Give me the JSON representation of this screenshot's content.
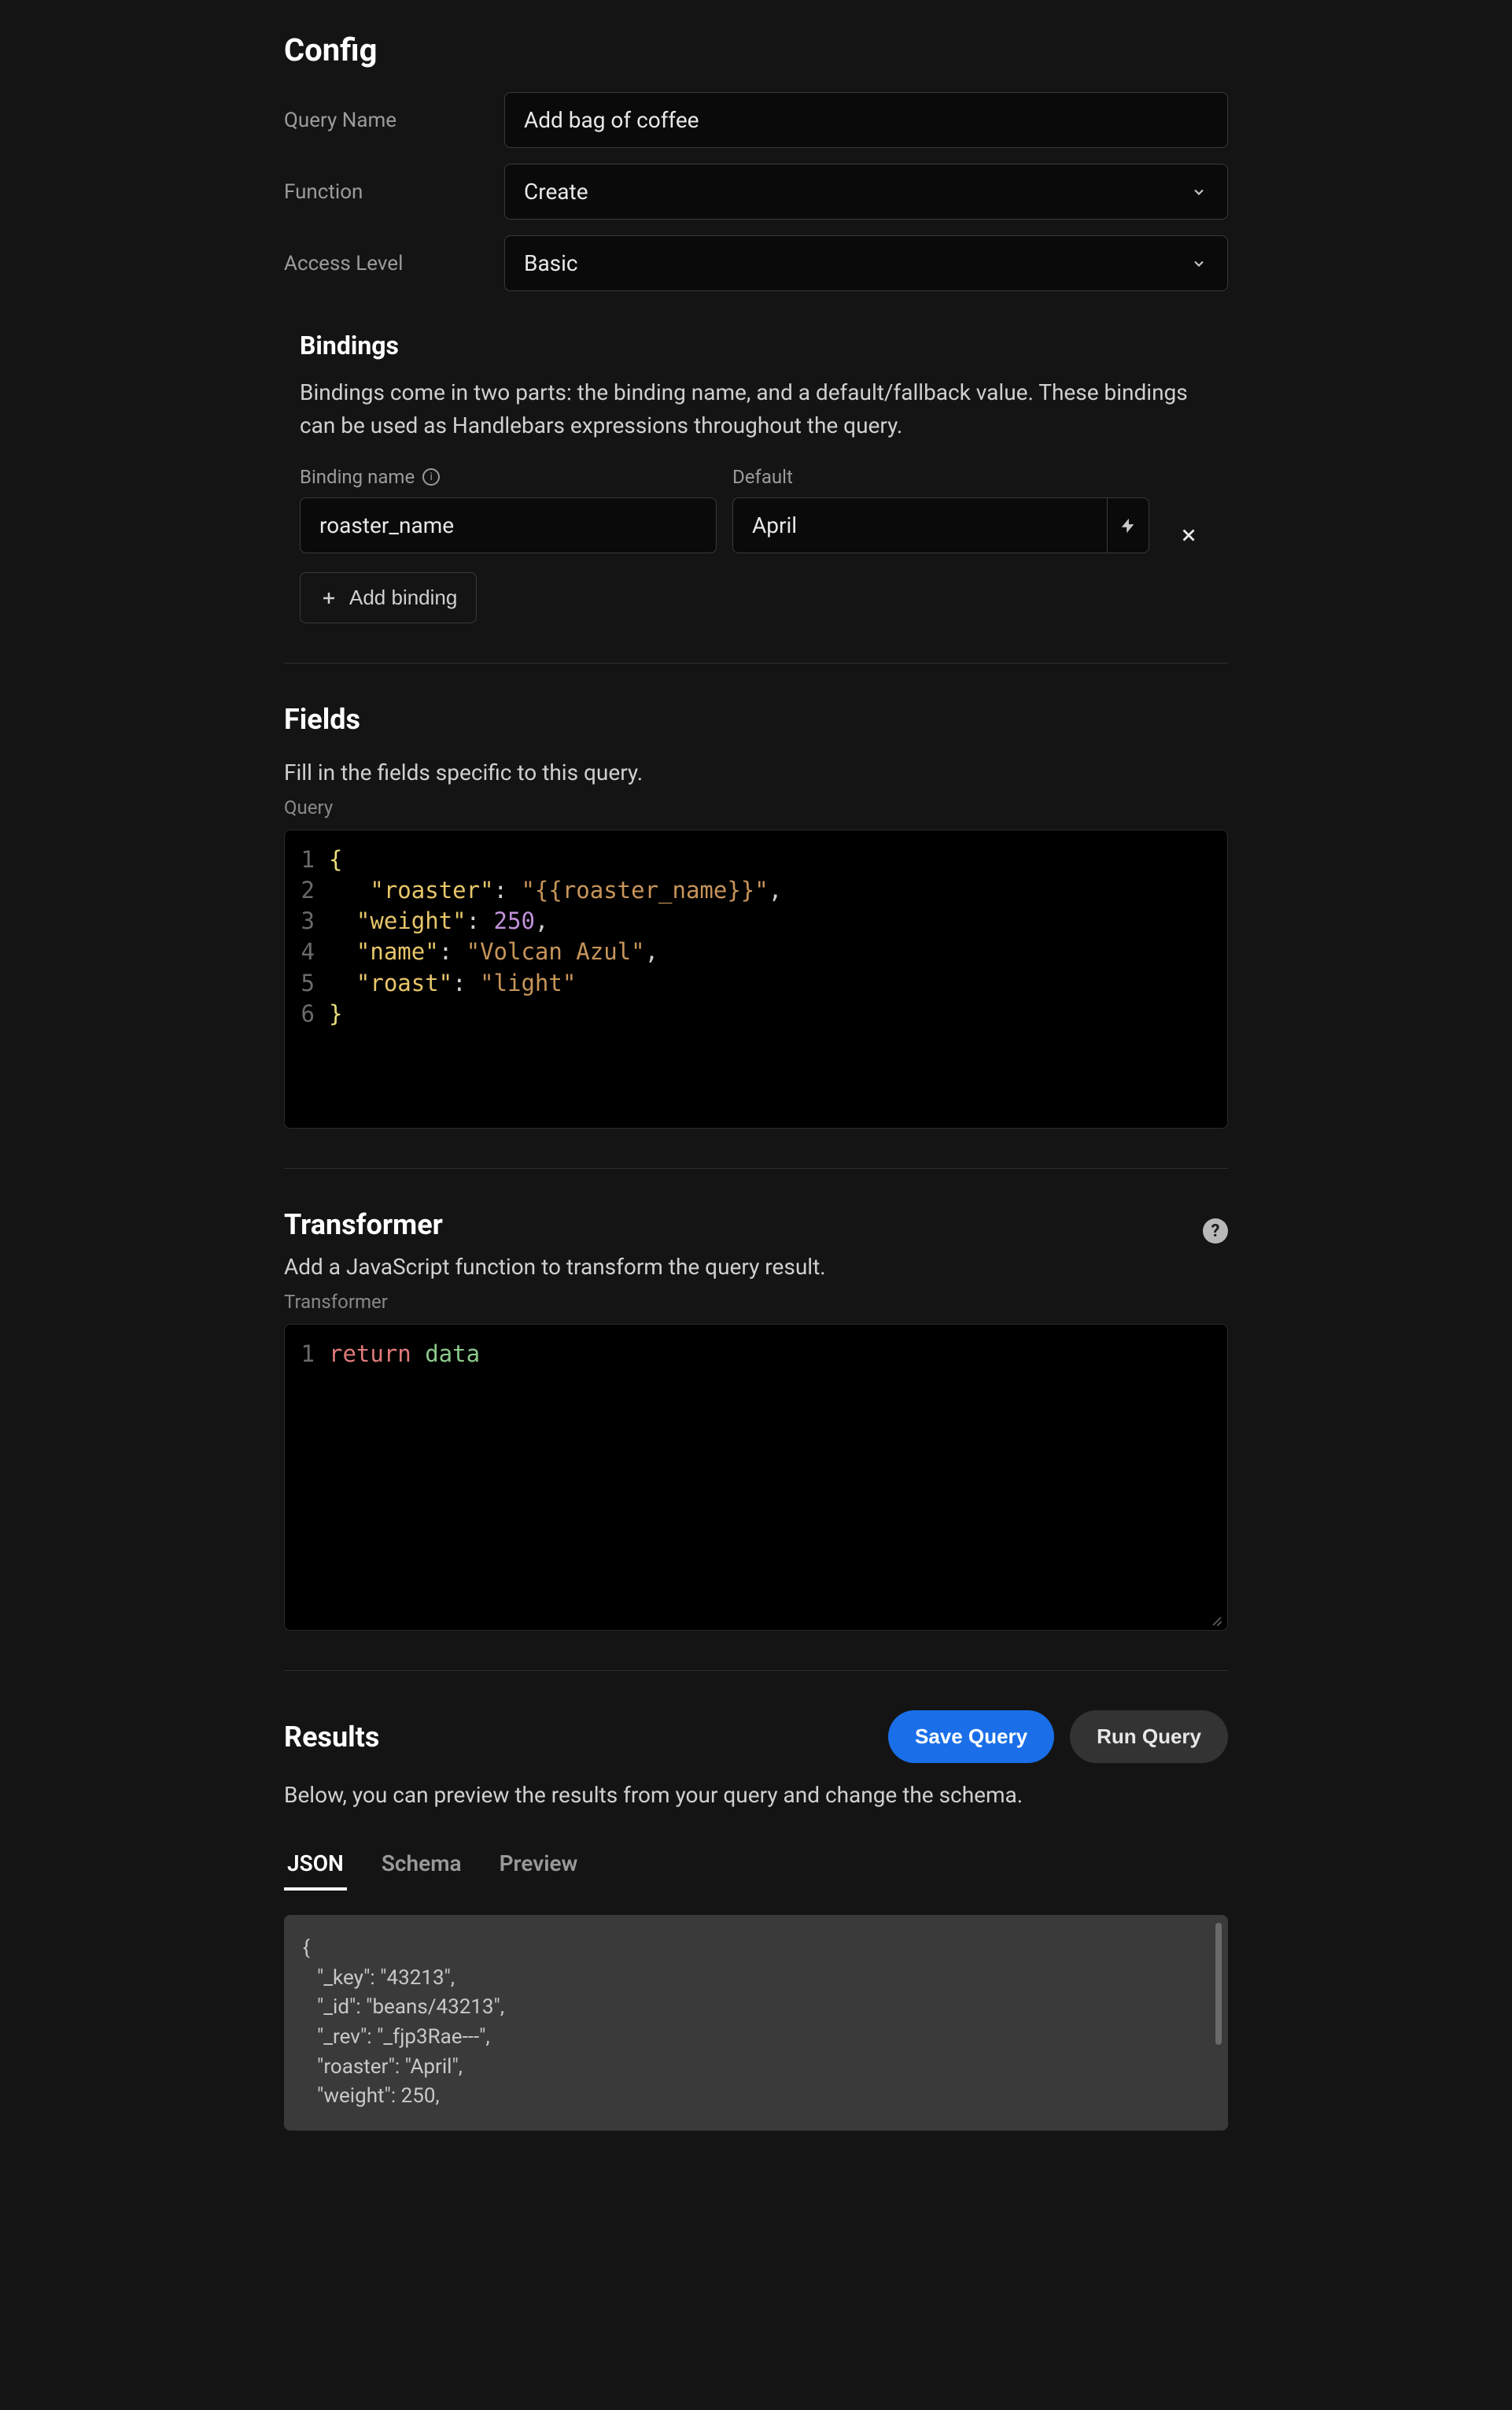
{
  "config": {
    "title": "Config",
    "query_name_label": "Query Name",
    "query_name_value": "Add bag of coffee",
    "function_label": "Function",
    "function_value": "Create",
    "access_level_label": "Access Level",
    "access_level_value": "Basic"
  },
  "bindings": {
    "title": "Bindings",
    "description": "Bindings come in two parts: the binding name, and a default/fallback value. These bindings can be used as Handlebars expressions throughout the query.",
    "name_label": "Binding name",
    "default_label": "Default",
    "rows": [
      {
        "name": "roaster_name",
        "default": "April"
      }
    ],
    "add_label": "Add binding"
  },
  "fields": {
    "title": "Fields",
    "description": "Fill in the fields specific to this query.",
    "label": "Query",
    "code": [
      [
        {
          "t": "brace",
          "v": "{"
        }
      ],
      [
        {
          "t": "plain",
          "v": "   "
        },
        {
          "t": "key",
          "v": "\"roaster\""
        },
        {
          "t": "punct",
          "v": ": "
        },
        {
          "t": "str",
          "v": "\"{{roaster_name}}\""
        },
        {
          "t": "punct",
          "v": ","
        }
      ],
      [
        {
          "t": "plain",
          "v": "  "
        },
        {
          "t": "key",
          "v": "\"weight\""
        },
        {
          "t": "punct",
          "v": ": "
        },
        {
          "t": "num",
          "v": "250"
        },
        {
          "t": "punct",
          "v": ","
        }
      ],
      [
        {
          "t": "plain",
          "v": "  "
        },
        {
          "t": "key",
          "v": "\"name\""
        },
        {
          "t": "punct",
          "v": ": "
        },
        {
          "t": "str",
          "v": "\"Volcan Azul\""
        },
        {
          "t": "punct",
          "v": ","
        }
      ],
      [
        {
          "t": "plain",
          "v": "  "
        },
        {
          "t": "key",
          "v": "\"roast\""
        },
        {
          "t": "punct",
          "v": ": "
        },
        {
          "t": "str",
          "v": "\"light\""
        }
      ],
      [
        {
          "t": "brace",
          "v": "}"
        }
      ]
    ]
  },
  "transformer": {
    "title": "Transformer",
    "description": "Add a JavaScript function to transform the query result.",
    "label": "Transformer",
    "code": [
      [
        {
          "t": "kw",
          "v": "return "
        },
        {
          "t": "var",
          "v": "data"
        }
      ]
    ]
  },
  "results": {
    "title": "Results",
    "save_label": "Save Query",
    "run_label": "Run Query",
    "description": "Below, you can preview the results from your query and change the schema.",
    "tabs": [
      {
        "label": "JSON",
        "active": true
      },
      {
        "label": "Schema",
        "active": false
      },
      {
        "label": "Preview",
        "active": false
      }
    ],
    "output": [
      "{",
      "\"_key\": \"43213\",",
      "\"_id\": \"beans/43213\",",
      "\"_rev\": \"_fjp3Rae---\",",
      "\"roaster\": \"April\",",
      "\"weight\": 250,"
    ]
  }
}
